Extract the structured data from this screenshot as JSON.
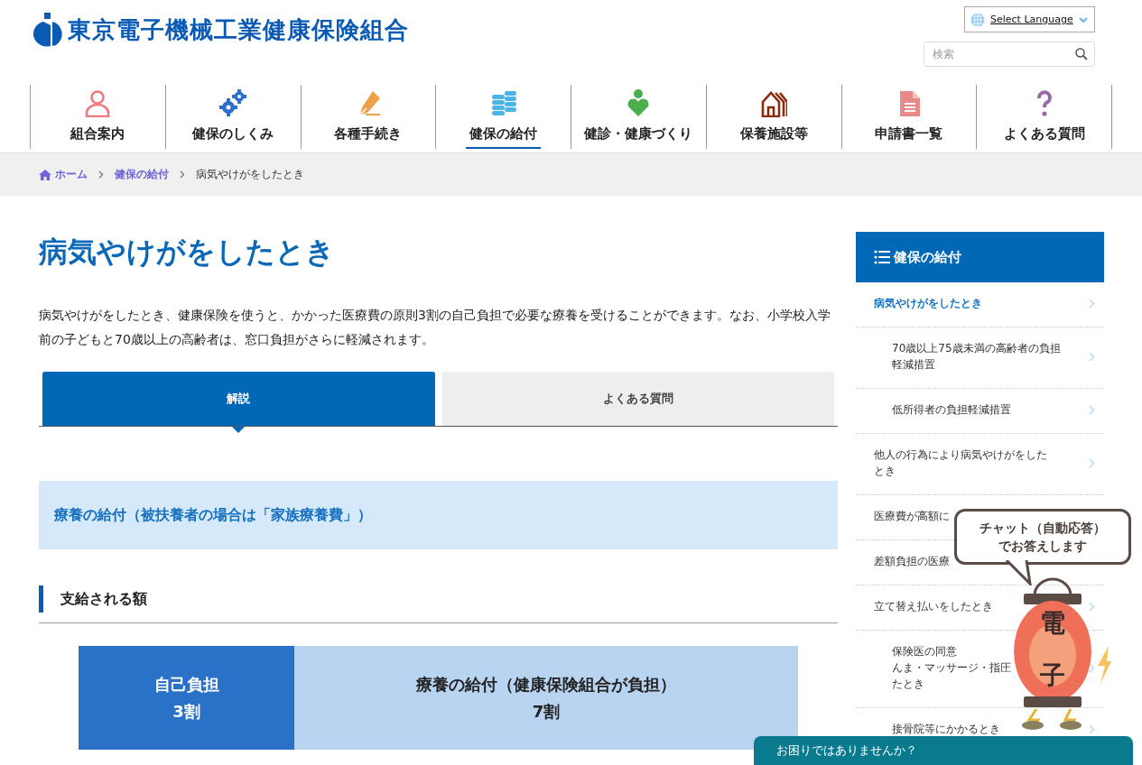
{
  "header": {
    "site_title": "東京電子機械工業健康保険組合",
    "language_select": "Select Language",
    "search": {
      "placeholder": "検索"
    }
  },
  "nav": [
    {
      "label": "組合案内",
      "selected": false
    },
    {
      "label": "健保のしくみ",
      "selected": false
    },
    {
      "label": "各種手続き",
      "selected": false
    },
    {
      "label": "健保の給付",
      "selected": true
    },
    {
      "label": "健診・健康づくり",
      "selected": false
    },
    {
      "label": "保養施設等",
      "selected": false
    },
    {
      "label": "申請書一覧",
      "selected": false
    },
    {
      "label": "よくある質問",
      "selected": false
    }
  ],
  "breadcrumb": [
    {
      "label": "ホーム",
      "kind": "home"
    },
    {
      "label": "健保の給付",
      "kind": "link"
    },
    {
      "label": "病気やけがをしたとき",
      "kind": "current"
    }
  ],
  "main": {
    "title": "病気やけがをしたとき",
    "intro": "病気やけがをしたとき、健康保険を使うと、かかった医療費の原則3割の自己負担で必要な療養を受けることができます。なお、小学校入学前の子どもと70歳以上の高齢者は、窓口負担がさらに軽減されます。",
    "tabs": [
      {
        "label": "解説",
        "selected": true
      },
      {
        "label": "よくある質問",
        "selected": false
      }
    ],
    "notice": "療養の給付（被扶養者の場合は「家族療養費」）",
    "section_heading": "支給される額",
    "share_bar": [
      {
        "label": "自己負担",
        "value": "3割",
        "kind": "self"
      },
      {
        "label": "療養の給付（健康保険組合が負担）",
        "value": "7割",
        "kind": "insurer"
      }
    ]
  },
  "sidebar": {
    "title": "健保の給付",
    "items": [
      {
        "lines": [
          "病気やけがをしたとき"
        ],
        "selected": true,
        "children": [
          {
            "lines": [
              "70歳以上75歳未満の高齢者の負担",
              "軽減措置"
            ],
            "selected": false
          },
          {
            "lines": [
              "低所得者の負担軽減措置"
            ],
            "selected": false
          }
        ]
      },
      {
        "lines": [
          "他人の行為により病気やけがをした",
          "とき"
        ],
        "selected": false
      },
      {
        "lines": [
          "医療費が高額に"
        ],
        "selected": false,
        "chevron": false
      },
      {
        "lines": [
          "差額負担の医療"
        ],
        "selected": false,
        "chevron": false
      },
      {
        "lines": [
          "立て替え払いをしたとき"
        ],
        "selected": false,
        "children": [
          {
            "lines": [
              "保険医の同意",
              "んま・マッサージ・指圧",
              "たとき"
            ],
            "selected": false
          },
          {
            "lines": [
              "接骨院等にかかるとき"
            ],
            "selected": false
          }
        ]
      }
    ]
  },
  "chat": {
    "bubble_lines": [
      "チャット（自動応答）",
      "でお答えします"
    ],
    "lantern_glyphs": [
      "電",
      "子"
    ],
    "help_bar": "お困りではありませんか？"
  }
}
